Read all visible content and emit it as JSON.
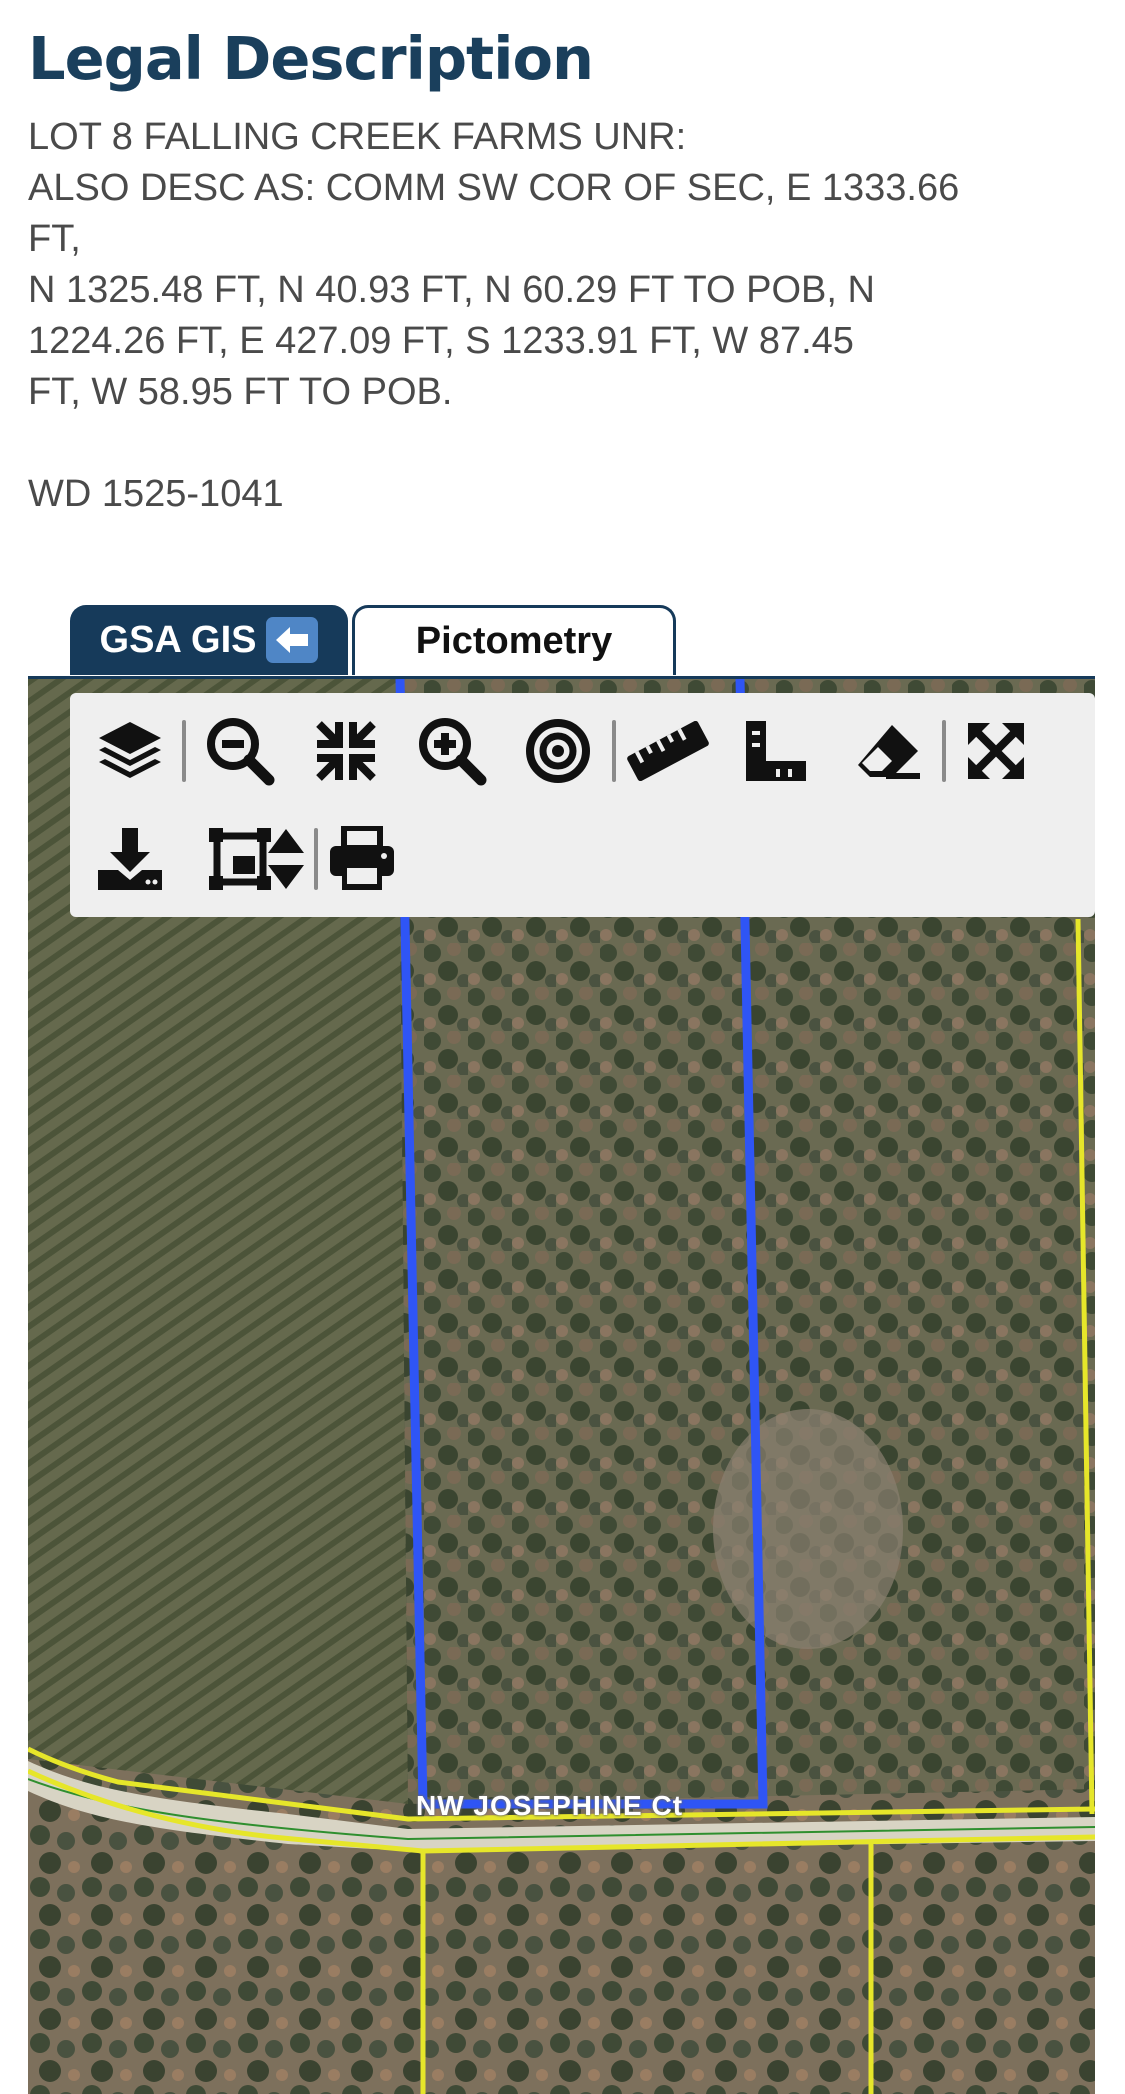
{
  "legal": {
    "title": "Legal Description",
    "lines": [
      "LOT 8 FALLING CREEK FARMS UNR:",
      "ALSO DESC AS: COMM SW COR OF SEC, E 1333.66",
      "FT,",
      "N 1325.48 FT, N 40.93 FT, N 60.29 FT TO POB, N",
      "1224.26 FT, E 427.09 FT, S 1233.91 FT, W 87.45",
      "FT, W 58.95 FT TO POB."
    ],
    "deed": "WD 1525-1041"
  },
  "tabs": {
    "gis_label": "GSA GIS",
    "gis_icon": "left-arrow-icon",
    "pictometry_label": "Pictometry"
  },
  "toolbar": {
    "tools": [
      "layers-icon",
      "zoom-out-icon",
      "zoom-to-extent-icon",
      "zoom-in-icon",
      "locate-target-icon",
      "measure-distance-icon",
      "measure-area-icon",
      "eraser-icon",
      "fullscreen-icon",
      "download-icon",
      "print-area-icon",
      "resize-icon",
      "print-icon"
    ]
  },
  "map": {
    "road_label": "NW JOSEPHINE Ct",
    "colors": {
      "selected_parcel": "#2f55f5",
      "parcel_lines": "#e6e62a",
      "centerline": "#2f8f2f",
      "toolbar_bg": "#efefef",
      "tab_active": "#163a5a",
      "title": "#1a3f5c"
    }
  }
}
